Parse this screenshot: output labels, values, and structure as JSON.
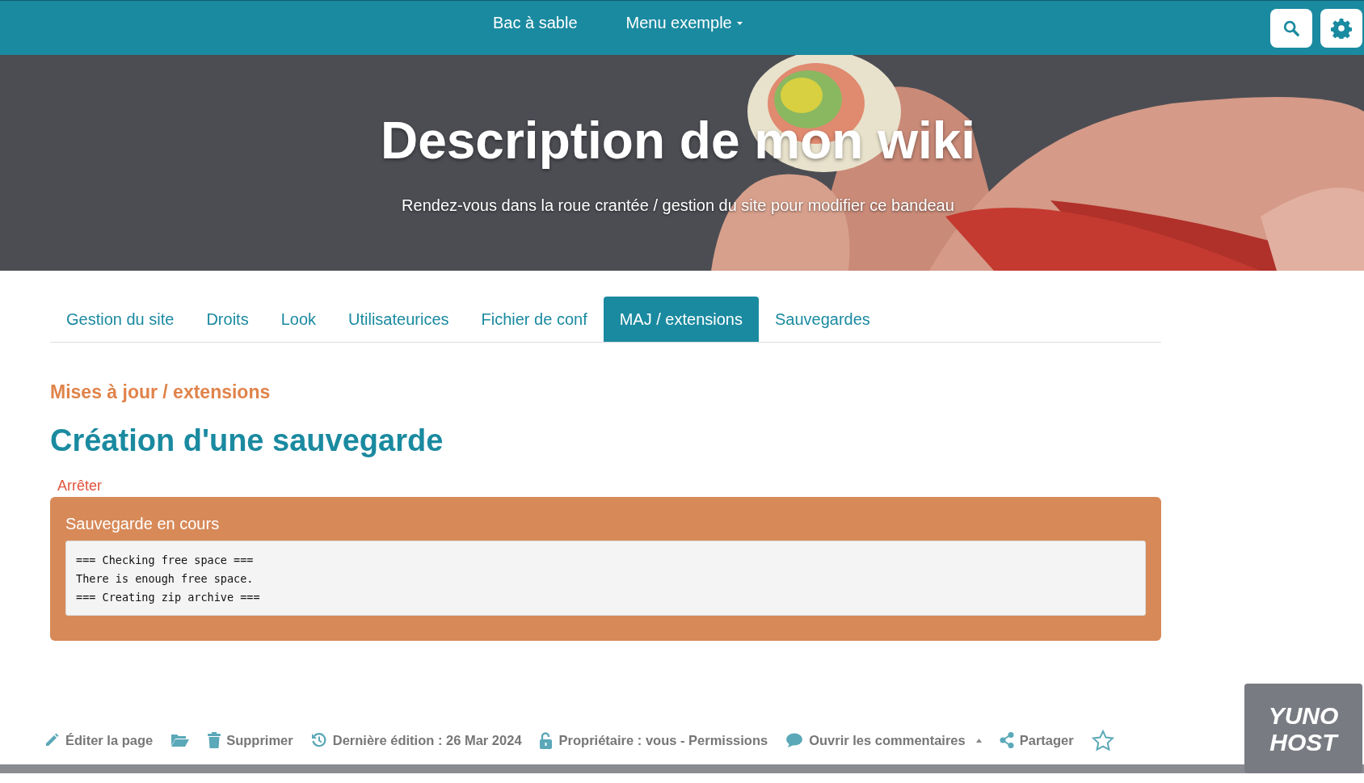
{
  "navbar": {
    "links": [
      {
        "label": "Bac à sable",
        "dropdown": false
      },
      {
        "label": "Menu exemple",
        "dropdown": true
      }
    ],
    "buttons": [
      {
        "kind": "search"
      },
      {
        "kind": "settings"
      }
    ]
  },
  "banner": {
    "title": "Description de mon wiki",
    "subtitle": "Rendez-vous dans la roue crantée / gestion du site pour modifier ce bandeau"
  },
  "tabs": [
    {
      "label": "Gestion du site",
      "selected": false
    },
    {
      "label": "Droits",
      "selected": false
    },
    {
      "label": "Look",
      "selected": false
    },
    {
      "label": "Utilisateurices",
      "selected": false
    },
    {
      "label": "Fichier de conf",
      "selected": false
    },
    {
      "label": "MAJ / extensions",
      "selected": true
    },
    {
      "label": "Sauvegardes",
      "selected": false
    }
  ],
  "section_label": "Mises à jour / extensions",
  "page_title": "Création d'une sauvegarde",
  "stop_link": "Arrêter",
  "backup_panel": {
    "title": "Sauvegarde en cours",
    "log": [
      "=== Checking free space ===",
      "There is enough free space.",
      "=== Creating zip archive ==="
    ]
  },
  "footer_actions": [
    {
      "kind": "edit",
      "label": "Éditer la page"
    },
    {
      "kind": "folder"
    },
    {
      "kind": "delete",
      "label": "Supprimer"
    },
    {
      "kind": "history",
      "label": "Dernière édition : 26 Mar 2024"
    },
    {
      "kind": "lock",
      "label": "Propriétaire : vous - Permissions"
    },
    {
      "kind": "comment",
      "label": "Ouvrir les commentaires"
    },
    {
      "kind": "share",
      "label": "Partager"
    },
    {
      "kind": "favorite"
    }
  ],
  "badge": {
    "lines": [
      "YUNO",
      "HOST"
    ]
  }
}
